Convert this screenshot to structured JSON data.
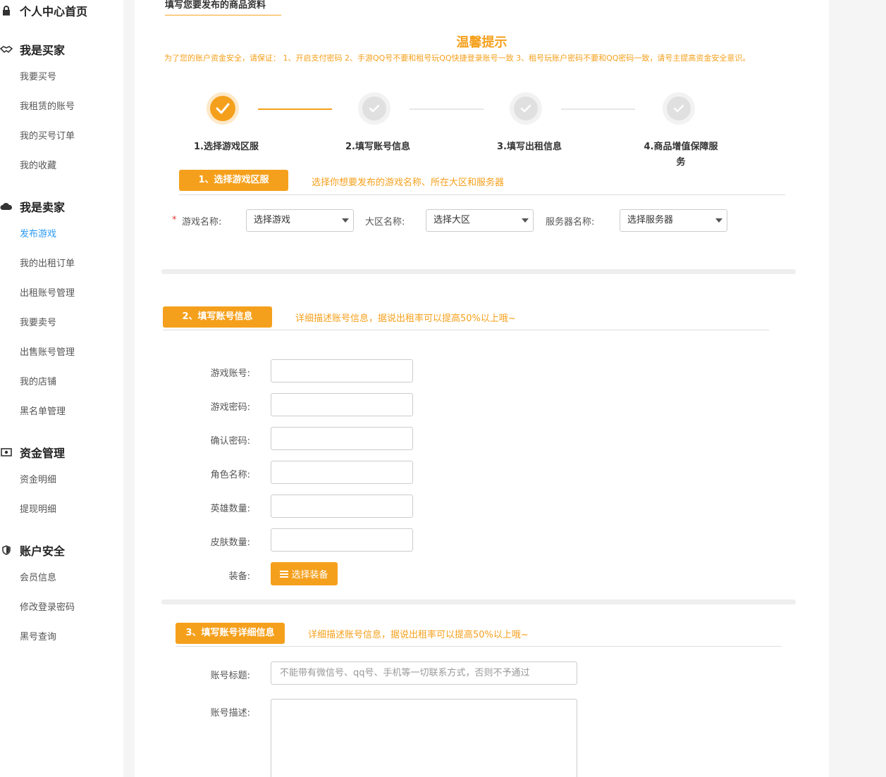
{
  "sidebar": {
    "home": "个人中心首页",
    "buyer": {
      "title": "我是买家",
      "items": [
        "我要买号",
        "我租赁的账号",
        "我的买号订单",
        "我的收藏"
      ]
    },
    "seller": {
      "title": "我是卖家",
      "items": [
        "发布游戏",
        "我的出租订单",
        "出租账号管理",
        "我要卖号",
        "出售账号管理",
        "我的店铺",
        "黑名单管理"
      ],
      "active_index": 0
    },
    "funds": {
      "title": "资金管理",
      "items": [
        "资金明细",
        "提现明细"
      ]
    },
    "security": {
      "title": "账户安全",
      "items": [
        "会员信息",
        "修改登录密码",
        "黑号查询"
      ]
    }
  },
  "main": {
    "page_title": "填写您要发布的商品资料",
    "tips_title": "温馨提示",
    "tips_text": "为了您的账户资金安全，请保证：  1、开启支付密码 2、手游QQ号不要和租号玩QQ快捷登录账号一致 3、租号玩账户密码不要和QQ密码一致，请号主提高资金安全意识。",
    "steps": [
      {
        "label": "1.选择游戏区服",
        "done": true
      },
      {
        "label": "2.填写账号信息",
        "done": false
      },
      {
        "label": "3.填写出租信息",
        "done": false
      },
      {
        "label": "4.商品增值保障服务",
        "label_line1": "4.商品增值保障服",
        "label_line2": "务",
        "done": false
      }
    ],
    "section1": {
      "button": "1、选择游戏区服",
      "desc": "选择你想要发布的游戏名称、所在大区和服务器",
      "required_mark": "*",
      "game_label": "游戏名称:",
      "game_value": "选择游戏",
      "region_label": "大区名称:",
      "region_value": "选择大区",
      "server_label": "服务器名称:",
      "server_value": "选择服务器"
    },
    "section2": {
      "button": "2、填写账号信息",
      "desc": "详细描述账号信息，据说出租率可以提高50%以上哦~",
      "fields": [
        {
          "label": "游戏账号:",
          "value": ""
        },
        {
          "label": "游戏密码:",
          "value": ""
        },
        {
          "label": "确认密码:",
          "value": ""
        },
        {
          "label": "角色名称:",
          "value": ""
        },
        {
          "label": "英雄数量:",
          "value": ""
        },
        {
          "label": "皮肤数量:",
          "value": ""
        }
      ],
      "equip_label": "装备:",
      "equip_button": "选择装备"
    },
    "section3": {
      "button": "3、填写账号详细信息",
      "desc": "详细描述账号信息，据说出租率可以提高50%以上哦~",
      "title_label": "账号标题:",
      "title_placeholder": "不能带有微信号、qq号、手机等一切联系方式，否则不予通过",
      "desc_label": "账号描述:"
    }
  },
  "colors": {
    "accent": "#f5a01c",
    "active_link": "#2b9af3"
  }
}
